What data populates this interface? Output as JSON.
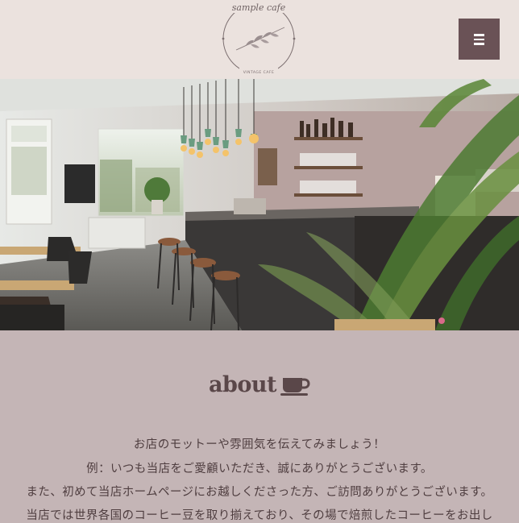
{
  "header": {
    "logo_top_text": "sample cafe",
    "logo_bottom_text": "VINTAGE CAFE",
    "menu_icon": "hamburger-menu-icon"
  },
  "hero": {
    "image": "cafe interior with bar counter, stools, shelves of bottles and plant"
  },
  "about": {
    "title": "about",
    "title_icon": "coffee-cup-icon",
    "lines": [
      "お店のモットーや雰囲気を伝えてみましょう！",
      "例：いつも当店をご愛顧いただき、誠にありがとうございます。",
      "また、初めて当店ホームページにお越しくださった方、ご訪問ありがとうございます。",
      "当店では世界各国のコーヒー豆を取り揃えており、その場で焙煎したコーヒーをお出し"
    ]
  },
  "colors": {
    "header_bg": "#ebe2de",
    "accent": "#6a5256",
    "section_bg": "#c4b5b6",
    "text": "#5b4a4b"
  }
}
